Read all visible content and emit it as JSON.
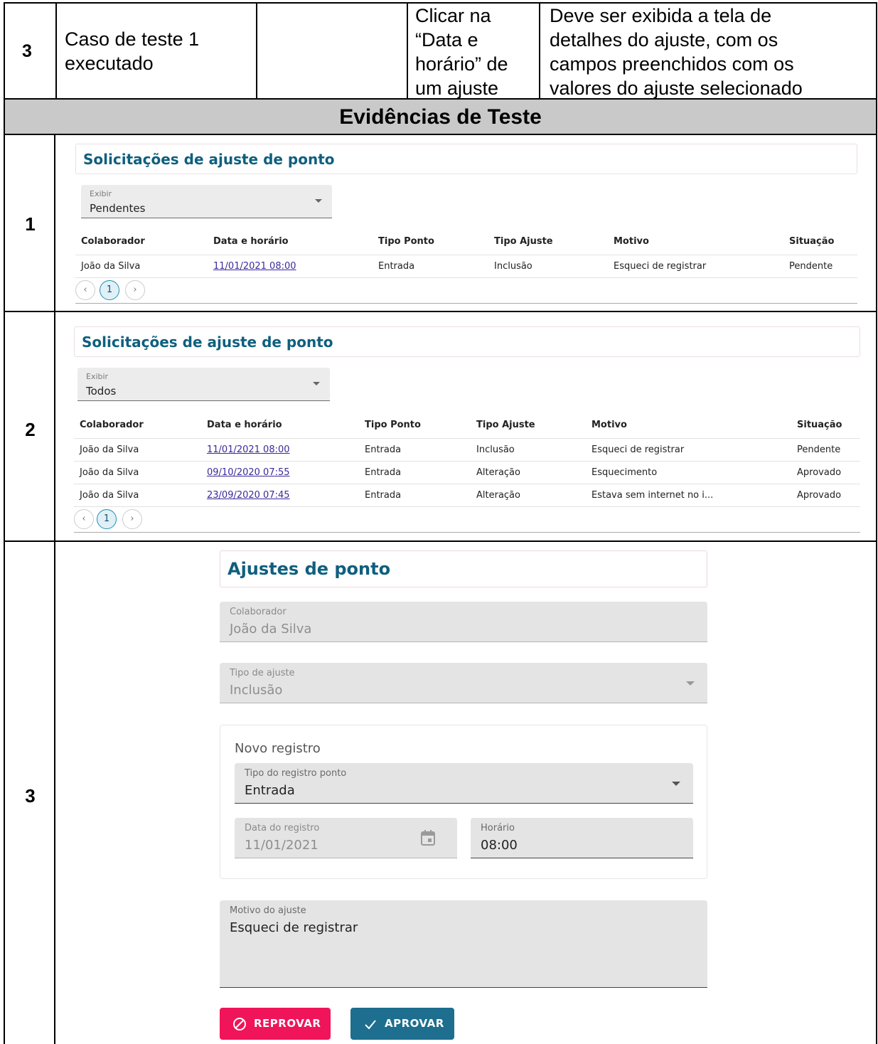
{
  "top_row": {
    "step": "3",
    "precondition_lines": [
      "Caso de teste 1",
      "executado"
    ],
    "action_lines": [
      "Clicar na",
      "“Data e",
      "horário” de",
      "um ajuste"
    ],
    "expected_lines": [
      "Deve ser exibida a tela de",
      "detalhes do ajuste, com os",
      "campos preenchidos com os",
      "valores do ajuste selecionado"
    ]
  },
  "evidence_header": "Evidências de Teste",
  "evidence": [
    {
      "number": "1",
      "title": "Solicitações de ajuste de ponto",
      "filter_label": "Exibir",
      "filter_value": "Pendentes",
      "columns": [
        "Colaborador",
        "Data e horário",
        "Tipo Ponto",
        "Tipo Ajuste",
        "Motivo",
        "Situação"
      ],
      "rows": [
        [
          "João da Silva",
          "11/01/2021 08:00",
          "Entrada",
          "Inclusão",
          "Esqueci de registrar",
          "Pendente"
        ]
      ],
      "pager": {
        "prev": "‹",
        "page": "1",
        "next": "›"
      }
    },
    {
      "number": "2",
      "title": "Solicitações de ajuste de ponto",
      "filter_label": "Exibir",
      "filter_value": "Todos",
      "columns": [
        "Colaborador",
        "Data e horário",
        "Tipo Ponto",
        "Tipo Ajuste",
        "Motivo",
        "Situação"
      ],
      "rows": [
        [
          "João da Silva",
          "11/01/2021 08:00",
          "Entrada",
          "Inclusão",
          "Esqueci de registrar",
          "Pendente"
        ],
        [
          "João da Silva",
          "09/10/2020 07:55",
          "Entrada",
          "Alteração",
          "Esquecimento",
          "Aprovado"
        ],
        [
          "João da Silva",
          "23/09/2020 07:45",
          "Entrada",
          "Alteração",
          "Estava sem internet no i...",
          "Aprovado"
        ]
      ],
      "pager": {
        "prev": "‹",
        "page": "1",
        "next": "›"
      }
    },
    {
      "number": "3",
      "title": "Ajustes de ponto",
      "colaborador": {
        "label": "Colaborador",
        "value": "João da Silva"
      },
      "tipo_ajuste": {
        "label": "Tipo de ajuste",
        "value": "Inclusão"
      },
      "novo_registro": {
        "heading": "Novo registro",
        "tipo_registro": {
          "label": "Tipo do registro ponto",
          "value": "Entrada"
        },
        "data": {
          "label": "Data do registro",
          "value": "11/01/2021"
        },
        "horario": {
          "label": "Horário",
          "value": "08:00"
        }
      },
      "motivo": {
        "label": "Motivo do ajuste",
        "value": "Esqueci de registrar"
      },
      "buttons": {
        "reject": "REPROVAR",
        "approve": "APROVAR"
      },
      "colors": {
        "title": "#0f5f7e",
        "reject": "#f0145a",
        "approve": "#1d6e8f",
        "link": "#3a2a9a"
      }
    }
  ]
}
